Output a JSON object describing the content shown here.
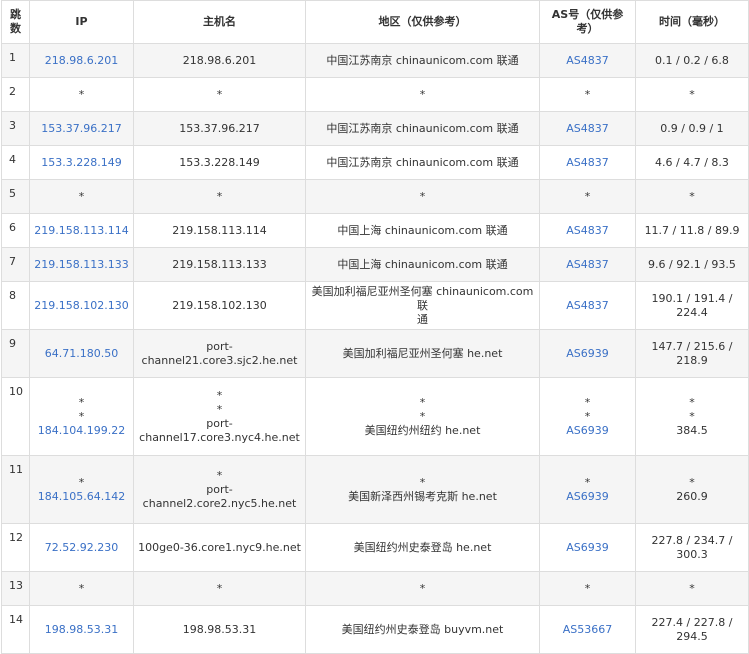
{
  "headers": {
    "hop": "跳数",
    "ip": "IP",
    "host": "主机名",
    "location": "地区（仅供参考）",
    "as": "AS号（仅供参考）",
    "time": "时间（毫秒）"
  },
  "rows": [
    {
      "hop": "1",
      "ip": [
        "218.98.6.201"
      ],
      "host": [
        "218.98.6.201"
      ],
      "loc": [
        "中国江苏南京 chinaunicom.com 联通"
      ],
      "as": [
        "AS4837"
      ],
      "time": [
        "0.1 / 0.2 / 6.8"
      ]
    },
    {
      "hop": "2",
      "ip": [
        "*"
      ],
      "host": [
        "*"
      ],
      "loc": [
        "*"
      ],
      "as": [
        "*"
      ],
      "time": [
        "*"
      ]
    },
    {
      "hop": "3",
      "ip": [
        "153.37.96.217"
      ],
      "host": [
        "153.37.96.217"
      ],
      "loc": [
        "中国江苏南京 chinaunicom.com 联通"
      ],
      "as": [
        "AS4837"
      ],
      "time": [
        "0.9 / 0.9 / 1"
      ]
    },
    {
      "hop": "4",
      "ip": [
        "153.3.228.149"
      ],
      "host": [
        "153.3.228.149"
      ],
      "loc": [
        "中国江苏南京 chinaunicom.com 联通"
      ],
      "as": [
        "AS4837"
      ],
      "time": [
        "4.6 / 4.7 / 8.3"
      ]
    },
    {
      "hop": "5",
      "ip": [
        "*"
      ],
      "host": [
        "*"
      ],
      "loc": [
        "*"
      ],
      "as": [
        "*"
      ],
      "time": [
        "*"
      ]
    },
    {
      "hop": "6",
      "ip": [
        "219.158.113.114"
      ],
      "host": [
        "219.158.113.114"
      ],
      "loc": [
        "中国上海 chinaunicom.com 联通"
      ],
      "as": [
        "AS4837"
      ],
      "time": [
        "11.7 / 11.8 / 89.9"
      ]
    },
    {
      "hop": "7",
      "ip": [
        "219.158.113.133"
      ],
      "host": [
        "219.158.113.133"
      ],
      "loc": [
        "中国上海 chinaunicom.com 联通"
      ],
      "as": [
        "AS4837"
      ],
      "time": [
        "9.6 / 92.1 / 93.5"
      ]
    },
    {
      "hop": "8",
      "ip": [
        "219.158.102.130"
      ],
      "host": [
        "219.158.102.130"
      ],
      "loc": [
        "美国加利福尼亚州圣何塞 chinaunicom.com 联",
        "通"
      ],
      "as": [
        "AS4837"
      ],
      "time": [
        "190.1 / 191.4 /",
        "224.4"
      ]
    },
    {
      "hop": "9",
      "ip": [
        "64.71.180.50"
      ],
      "host": [
        "port-channel21.core3.sjc2.he.net"
      ],
      "loc": [
        "美国加利福尼亚州圣何塞 he.net"
      ],
      "as": [
        "AS6939"
      ],
      "time": [
        "147.7 / 215.6 /",
        "218.9"
      ]
    },
    {
      "hop": "10",
      "ip": [
        "*",
        "*",
        "184.104.199.22"
      ],
      "host": [
        "*",
        "*",
        "port-",
        "channel17.core3.nyc4.he.net"
      ],
      "loc": [
        "*",
        "*",
        "美国纽约州纽约 he.net"
      ],
      "as": [
        "*",
        "*",
        "AS6939"
      ],
      "time": [
        "*",
        "*",
        "384.5"
      ]
    },
    {
      "hop": "11",
      "ip": [
        "*",
        "184.105.64.142"
      ],
      "host": [
        "*",
        "port-channel2.core2.nyc5.he.net"
      ],
      "loc": [
        "*",
        "美国新泽西州锡考克斯 he.net"
      ],
      "as": [
        "*",
        "AS6939"
      ],
      "time": [
        "*",
        "260.9"
      ]
    },
    {
      "hop": "12",
      "ip": [
        "72.52.92.230"
      ],
      "host": [
        "100ge0-36.core1.nyc9.he.net"
      ],
      "loc": [
        "美国纽约州史泰登岛 he.net"
      ],
      "as": [
        "AS6939"
      ],
      "time": [
        "227.8 / 234.7 /",
        "300.3"
      ]
    },
    {
      "hop": "13",
      "ip": [
        "*"
      ],
      "host": [
        "*"
      ],
      "loc": [
        "*"
      ],
      "as": [
        "*"
      ],
      "time": [
        "*"
      ]
    },
    {
      "hop": "14",
      "ip": [
        "198.98.53.31"
      ],
      "host": [
        "198.98.53.31"
      ],
      "loc": [
        "美国纽约州史泰登岛 buyvm.net"
      ],
      "as": [
        "AS53667"
      ],
      "time": [
        "227.4 / 227.8 /",
        "294.5"
      ]
    }
  ]
}
